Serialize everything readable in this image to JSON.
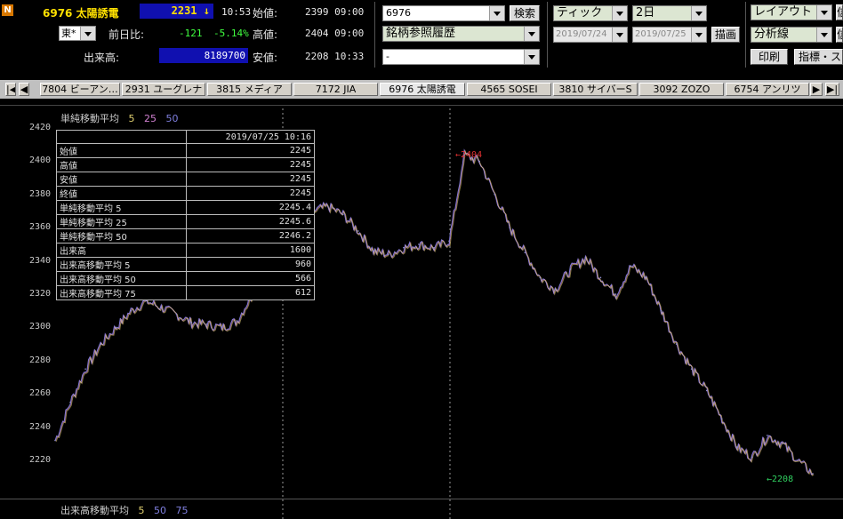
{
  "stock": {
    "code_name": "6976 太陽誘電",
    "price": "2231",
    "arrow": "↓",
    "time": "10:53",
    "exchange": "東*"
  },
  "quote": {
    "change_label": "前日比:",
    "change": "-121",
    "change_pct": "-5.14%",
    "volume_label": "出来高:",
    "volume": "8189700",
    "open_label": "始値:",
    "open": "2399 09:00",
    "high_label": "高値:",
    "high": "2404 09:00",
    "low_label": "安値:",
    "low": "2208 10:33"
  },
  "controls": {
    "code_input": "6976",
    "search_button": "検索",
    "history_combo": "銘柄参照履歴",
    "blank_combo": "-",
    "tick_combo": "ティック",
    "period_combo": "2日",
    "date_from": "2019/07/24",
    "date_to": "2019/07/25",
    "draw_button": "描画",
    "layout_combo": "レイアウト",
    "analysis_combo": "分析線",
    "print_button": "印刷",
    "indicator_button": "指標・ス",
    "right_cut1": "信",
    "right_cut2": "信"
  },
  "tabs": [
    "7804 ビーアン…",
    "2931 ユーグレナ",
    "3815 メディア",
    "7172 JIA",
    "6976 太陽誘電",
    "4565 SOSEI",
    "3810 サイバーS",
    "3092 ZOZO",
    "6754 アンリツ"
  ],
  "chart_header": {
    "title": "単純移動平均",
    "p1": "5",
    "p2": "25",
    "p3": "50"
  },
  "volume_header": {
    "title": "出来高移動平均",
    "p1": "5",
    "p2": "50",
    "p3": "75"
  },
  "tooltip": {
    "datetime": "2019/07/25 10:16",
    "rows": [
      [
        "始値",
        "2245"
      ],
      [
        "高値",
        "2245"
      ],
      [
        "安値",
        "2245"
      ],
      [
        "終値",
        "2245"
      ],
      [
        "単純移動平均 5",
        "2245.4"
      ],
      [
        "単純移動平均 25",
        "2245.6"
      ],
      [
        "単純移動平均 50",
        "2246.2"
      ],
      [
        "出来高",
        "1600"
      ],
      [
        "出来高移動平均 5",
        "960"
      ],
      [
        "出来高移動平均 50",
        "566"
      ],
      [
        "出来高移動平均 75",
        "612"
      ]
    ]
  },
  "annotations": {
    "high": "←2404",
    "low": "←2208"
  },
  "chart_data": {
    "type": "line",
    "yticks": [
      "2420",
      "2400",
      "2380",
      "2360",
      "2340",
      "2320",
      "2300",
      "2280",
      "2260",
      "2240",
      "2220"
    ],
    "ylim": [
      2210,
      2425
    ],
    "x": [
      0,
      2,
      4,
      6,
      8,
      10,
      12,
      14,
      16,
      18,
      20,
      22,
      24,
      26,
      28,
      30,
      32,
      34,
      36,
      38,
      40,
      42,
      44,
      46,
      48,
      50,
      52,
      54,
      56,
      58,
      60,
      62,
      64,
      66,
      68,
      70,
      72,
      74,
      76,
      78,
      80,
      82,
      84,
      86,
      88,
      90,
      92,
      94,
      96,
      98,
      100
    ],
    "series": [
      {
        "values": [
          2232,
          2255,
          2275,
          2290,
          2300,
          2310,
          2316,
          2312,
          2308,
          2303,
          2302,
          2300,
          2304,
          2320,
          2335,
          2352,
          2362,
          2370,
          2373,
          2368,
          2358,
          2346,
          2344,
          2348,
          2350,
          2348,
          2352,
          2404,
          2400,
          2380,
          2360,
          2345,
          2330,
          2323,
          2335,
          2342,
          2330,
          2320,
          2337,
          2330,
          2310,
          2290,
          2275,
          2262,
          2245,
          2228,
          2222,
          2235,
          2230,
          2220,
          2212
        ]
      }
    ]
  }
}
